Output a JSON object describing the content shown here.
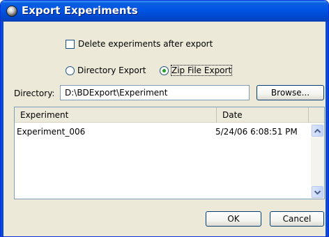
{
  "window": {
    "title": "Export Experiments"
  },
  "options": {
    "delete_after_export_label": "Delete experiments after export",
    "delete_after_export_checked": false
  },
  "export_type": {
    "directory_label": "Directory Export",
    "zip_label": "Zip File Export",
    "selected": "zip"
  },
  "directory": {
    "label": "Directory:",
    "value": "D:\\BDExport\\Experiment",
    "browse_label": "Browse..."
  },
  "table": {
    "columns": [
      "Experiment",
      "Date"
    ],
    "rows": [
      {
        "experiment": "Experiment_006",
        "date": "5/24/06 6:08:51 PM"
      }
    ]
  },
  "footer": {
    "ok_label": "OK",
    "cancel_label": "Cancel"
  },
  "icons": {
    "title": "app-icon",
    "scroll_up": "chevron-up-icon",
    "scroll_down": "chevron-down-icon"
  },
  "colors": {
    "titlebar": "#0054e3",
    "dialog_bg": "#ece9d8",
    "radio_dot": "#21a121",
    "scroll_arrow": "#4d6185"
  }
}
